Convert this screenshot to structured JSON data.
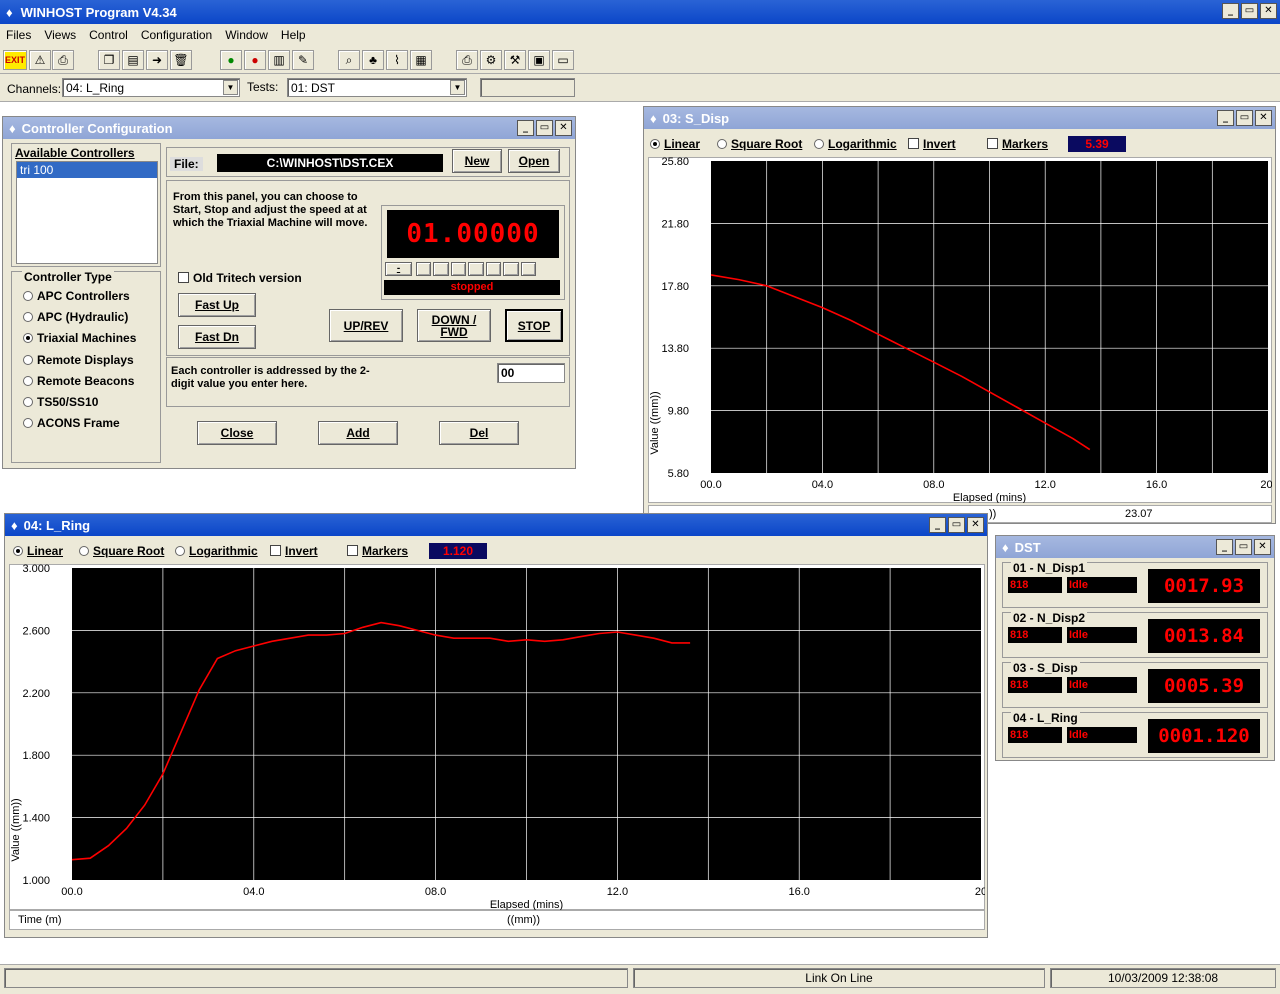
{
  "app": {
    "title": "WINHOST Program V4.34"
  },
  "menu": [
    "Files",
    "Views",
    "Control",
    "Configuration",
    "Window",
    "Help"
  ],
  "toolbar": {
    "exit_label": "EXIT",
    "channels_label": "Channels:",
    "channels_value": "04: L_Ring",
    "tests_label": "Tests:",
    "tests_value": "01: DST"
  },
  "controller": {
    "title": "Controller Configuration",
    "available_label": "Available Controllers",
    "controllers": [
      "tri 100"
    ],
    "type_label": "Controller Type",
    "types": [
      "APC Controllers",
      "APC (Hydraulic)",
      "Triaxial Machines",
      "Remote Displays",
      "Remote Beacons",
      "TS50/SS10",
      "ACONS Frame"
    ],
    "selected_type": "Triaxial Machines",
    "file_label": "File:",
    "file_value": "C:\\WINHOST\\DST.CEX",
    "new_label": "New",
    "open_label": "Open",
    "description": "From this panel, you can choose to Start, Stop and adjust the speed at at which the Triaxial Machine will move.",
    "speed_display": "01.00000",
    "minus_label": "-",
    "status": "stopped",
    "old_tritech_label": "Old Tritech version",
    "fast_up_label": "Fast Up",
    "fast_dn_label": "Fast Dn",
    "up_rev_label": "UP/REV",
    "down_fwd_label": "DOWN / FWD",
    "stop_label": "STOP",
    "address_text": "Each controller is addressed by the 2-digit value you enter here.",
    "address_value": "00",
    "close_label": "Close",
    "add_label": "Add",
    "del_label": "Del"
  },
  "sdisp": {
    "title": "03: S_Disp",
    "options": {
      "linear": "Linear",
      "sqrt": "Square Root",
      "log": "Logarithmic",
      "invert": "Invert",
      "markers": "Markers"
    },
    "value": "5.39",
    "ylabel": "Value  ((mm))",
    "xlabel": "Elapsed (mins)",
    "yticks": [
      "25.80",
      "21.80",
      "17.80",
      "13.80",
      "9.80",
      "5.80"
    ],
    "xticks": [
      "00.0",
      "04.0",
      "08.0",
      "12.0",
      "16.0",
      "20."
    ],
    "footer_value": "23.07",
    "footer_unit": "))"
  },
  "lring": {
    "title": "04: L_Ring",
    "options": {
      "linear": "Linear",
      "sqrt": "Square Root",
      "log": "Logarithmic",
      "invert": "Invert",
      "markers": "Markers"
    },
    "value": "1.120",
    "ylabel": "Value  ((mm))",
    "xlabel": "Elapsed (mins)",
    "yticks": [
      "3.000",
      "2.600",
      "2.200",
      "1.800",
      "1.400",
      "1.000"
    ],
    "xticks": [
      "00.0",
      "04.0",
      "08.0",
      "12.0",
      "16.0",
      "20"
    ],
    "footer_left": "Time (m)",
    "footer_mid": "((mm))"
  },
  "dst": {
    "title": "DST",
    "channels": [
      {
        "name": "01 - N_Disp1",
        "id": "818",
        "state": "Idle",
        "value": "0017.93"
      },
      {
        "name": "02 - N_Disp2",
        "id": "818",
        "state": "Idle",
        "value": "0013.84"
      },
      {
        "name": "03 - S_Disp",
        "id": "818",
        "state": "Idle",
        "value": "0005.39"
      },
      {
        "name": "04 - L_Ring",
        "id": "818",
        "state": "Idle",
        "value": "0001.120"
      }
    ]
  },
  "statusbar": {
    "link": "Link On Line",
    "datetime": "10/03/2009 12:38:08"
  },
  "colors": {
    "titlebar": "#0b46c8",
    "plot_bg": "#000000",
    "trace": "#ff0000",
    "led": "#ff0000"
  },
  "chart_data": [
    {
      "type": "line",
      "title": "03: S_Disp",
      "xlabel": "Elapsed (mins)",
      "ylabel": "Value  ((mm))",
      "xlim": [
        0,
        20
      ],
      "ylim": [
        5.8,
        25.8
      ],
      "grid": true,
      "series": [
        {
          "x": [
            0,
            1,
            2,
            3,
            4,
            5,
            6,
            7,
            8,
            9,
            10,
            11,
            12,
            13,
            13.6
          ],
          "y": [
            18.5,
            18.2,
            17.8,
            17.1,
            16.4,
            15.6,
            14.7,
            13.8,
            12.9,
            12.0,
            11.0,
            10.0,
            9.0,
            8.0,
            7.3
          ]
        }
      ]
    },
    {
      "type": "line",
      "title": "04: L_Ring",
      "xlabel": "Elapsed (mins)",
      "ylabel": "Value  ((mm))",
      "xlim": [
        0,
        20
      ],
      "ylim": [
        1.0,
        3.0
      ],
      "grid": true,
      "series": [
        {
          "x": [
            0,
            0.4,
            0.8,
            1.2,
            1.6,
            2.0,
            2.4,
            2.8,
            3.2,
            3.6,
            4.0,
            4.4,
            4.8,
            5.2,
            5.6,
            6.0,
            6.4,
            6.8,
            7.2,
            7.6,
            8.0,
            8.4,
            8.8,
            9.2,
            9.6,
            10.0,
            10.4,
            10.8,
            11.2,
            11.6,
            12.0,
            12.4,
            12.8,
            13.2,
            13.6
          ],
          "y": [
            1.13,
            1.14,
            1.22,
            1.33,
            1.48,
            1.68,
            1.95,
            2.22,
            2.42,
            2.47,
            2.5,
            2.53,
            2.55,
            2.57,
            2.57,
            2.58,
            2.62,
            2.65,
            2.63,
            2.6,
            2.57,
            2.55,
            2.55,
            2.55,
            2.53,
            2.54,
            2.53,
            2.54,
            2.56,
            2.58,
            2.59,
            2.57,
            2.55,
            2.52,
            2.52
          ]
        }
      ]
    }
  ]
}
